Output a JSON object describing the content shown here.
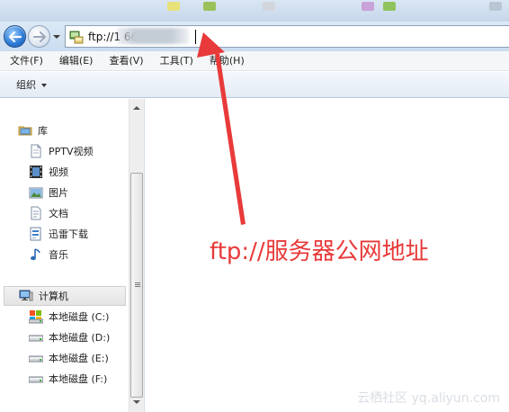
{
  "address": {
    "value": "ftp://1                    66/"
  },
  "menu": [
    "文件(F)",
    "编辑(E)",
    "查看(V)",
    "工具(T)",
    "帮助(H)"
  ],
  "toolbar": {
    "organize_label": "组织"
  },
  "nav": {
    "library": {
      "label": "库",
      "items": [
        "PPTV视频",
        "视频",
        "图片",
        "文档",
        "迅雷下载",
        "音乐"
      ]
    },
    "computer": {
      "label": "计算机",
      "drives": [
        "本地磁盘 (C:)",
        "本地磁盘 (D:)",
        "本地磁盘 (E:)",
        "本地磁盘 (F:)"
      ]
    }
  },
  "annotation": {
    "text": "ftp://服务器公网地址",
    "color": "#e83a3a"
  },
  "watermark": "云栖社区 yq.aliyun.com"
}
